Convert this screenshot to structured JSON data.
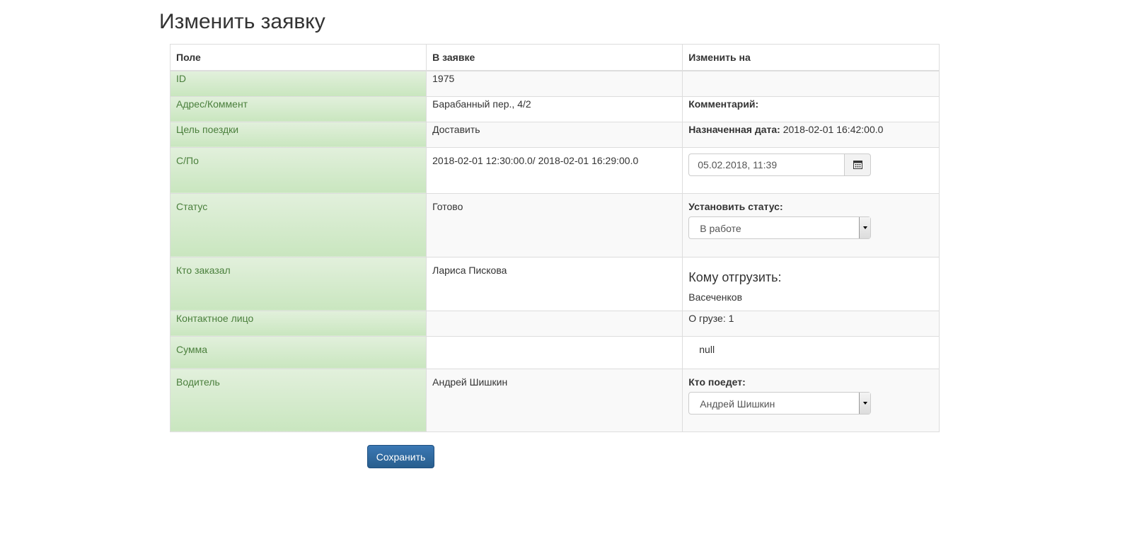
{
  "page": {
    "title": "Изменить заявку"
  },
  "table": {
    "headers": [
      "Поле",
      "В заявке",
      "Изменить на"
    ],
    "rows": [
      {
        "field": "ID",
        "current": "1975",
        "change": ""
      },
      {
        "field": "Адрес/Коммент",
        "current": "Барабанный пер., 4/2",
        "change_label": "Комментарий:"
      },
      {
        "field": "Цель поездки",
        "current": "Доставить",
        "change_label": "Назначенная дата:",
        "change_value": "2018-02-01 16:42:00.0"
      },
      {
        "field": "С/По",
        "current": "2018-02-01 12:30:00.0/ 2018-02-01 16:29:00.0",
        "date_input": "05.02.2018, 11:39",
        "date_icon": "calendar-icon"
      },
      {
        "field": "Статус",
        "current": "Готово",
        "change_label": "Установить статус:",
        "select_value": "В работе"
      },
      {
        "field": "Кто заказал",
        "current": "Лариса Пискова",
        "change_title": "Кому отгрузить:",
        "change_value": "Васеченков"
      },
      {
        "field": "Контактное лицо",
        "current": "",
        "change_value": "О грузе: 1"
      },
      {
        "field": "Сумма",
        "current": "",
        "change_value": "null"
      },
      {
        "field": "Водитель",
        "current": "Андрей Шишкин",
        "change_label": "Кто поедет:",
        "select_value": "Андрей Шишкин"
      }
    ]
  },
  "actions": {
    "save_label": "Сохранить"
  }
}
